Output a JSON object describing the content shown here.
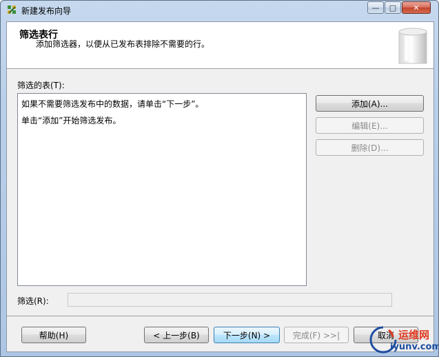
{
  "window": {
    "title": "新建发布向导",
    "controls": {
      "minimize": "—",
      "maximize": "□",
      "close": "✕"
    }
  },
  "header": {
    "title": "筛选表行",
    "subtitle": "添加筛选器，以便从已发布表排除不需要的行。",
    "graphic_icon": "database-cylinder-icon"
  },
  "tables": {
    "label": "筛选的表(T):",
    "lines": [
      "如果不需要筛选发布中的数据，请单击“下一步”。",
      "单击“添加”开始筛选发布。"
    ]
  },
  "side_buttons": {
    "add": "添加(A)...",
    "edit": "编辑(E)...",
    "delete": "删除(D)..."
  },
  "filter": {
    "label": "筛选(R):",
    "value": ""
  },
  "footer": {
    "help": "帮助(H)",
    "back": "< 上一步(B)",
    "next": "下一步(N) >",
    "finish": "完成(F) >>|",
    "cancel": "取消"
  },
  "watermark": {
    "line1": "运维网",
    "line2": "iyunv.com"
  }
}
